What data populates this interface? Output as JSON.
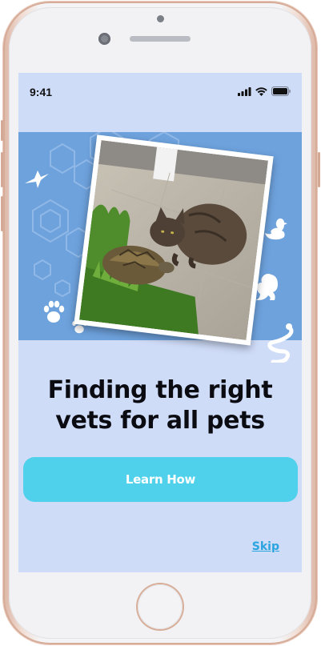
{
  "status_bar": {
    "time": "9:41"
  },
  "onboarding": {
    "headline_line1": "Finding the right",
    "headline_line2": "vets for all pets",
    "cta_label": "Learn How",
    "skip_label": "Skip",
    "photo_alt": "Cat and tortoise"
  },
  "colors": {
    "screen_bg": "#cfdcf8",
    "hero_bg": "#6ea2dd",
    "cta_bg": "#4fd1ec",
    "cta_text": "#ffffff",
    "skip_text": "#2aa4de",
    "headline_text": "#0b0b12"
  },
  "icons": [
    "hummingbird-icon",
    "paw-print-icon",
    "duck-icon",
    "squirrel-icon",
    "snake-icon",
    "signal-icon",
    "wifi-icon",
    "battery-icon"
  ]
}
